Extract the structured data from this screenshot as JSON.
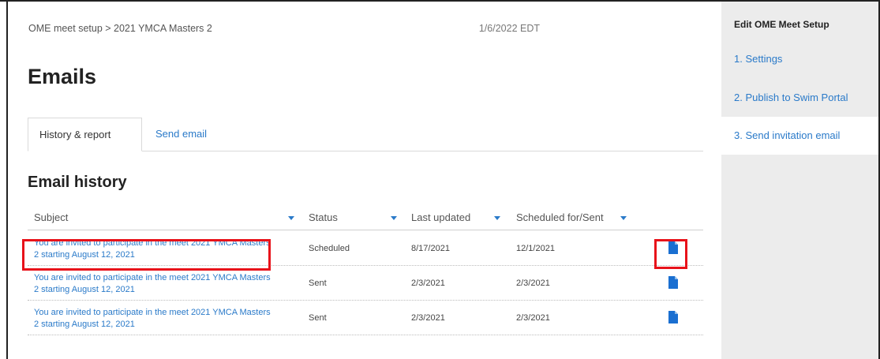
{
  "breadcrumb": "OME meet setup > 2021 YMCA Masters 2",
  "date": "1/6/2022 EDT",
  "page_title": "Emails",
  "tabs": [
    {
      "label": "History & report",
      "active": true
    },
    {
      "label": "Send email",
      "active": false
    }
  ],
  "section_title": "Email history",
  "table": {
    "headers": [
      "Subject",
      "Status",
      "Last updated",
      "Scheduled for/Sent"
    ],
    "rows": [
      {
        "subject": "You are invited to participate in the meet 2021 YMCA Masters 2 starting August 12, 2021",
        "status": "Scheduled",
        "last_updated": "8/17/2021",
        "scheduled": "12/1/2021",
        "icon": "document-icon"
      },
      {
        "subject": "You are invited to participate in the meet 2021 YMCA Masters 2 starting August 12, 2021",
        "status": "Sent",
        "last_updated": "2/3/2021",
        "scheduled": "2/3/2021",
        "icon": "document-icon"
      },
      {
        "subject": "You are invited to participate in the meet 2021 YMCA Masters 2 starting August 12, 2021",
        "status": "Sent",
        "last_updated": "2/3/2021",
        "scheduled": "2/3/2021",
        "icon": "document-icon"
      }
    ]
  },
  "sidebar": {
    "title": "Edit OME Meet Setup",
    "items": [
      {
        "label": "1. Settings",
        "active": false
      },
      {
        "label": "2. Publish to Swim Portal",
        "active": false
      },
      {
        "label": "3. Send invitation email",
        "active": true
      }
    ]
  },
  "colors": {
    "link": "#2a7ac9",
    "highlight": "#e8121a",
    "icon": "#1a6fd1",
    "sidebar_bg": "#ececec"
  }
}
